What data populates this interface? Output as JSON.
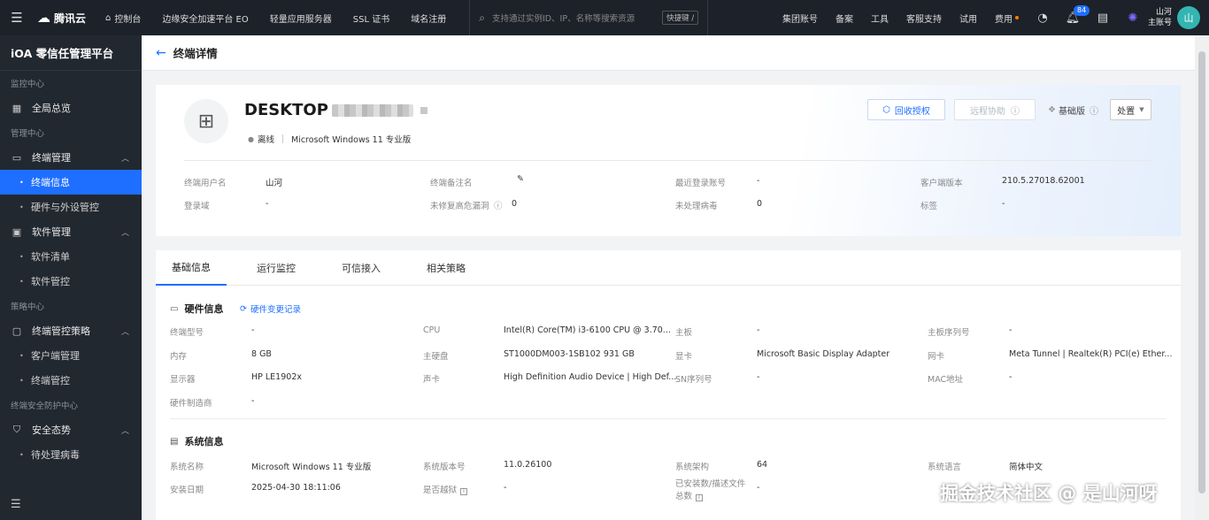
{
  "topbar": {
    "brand": "腾讯云",
    "console": "控制台",
    "nav": [
      "边缘安全加速平台 EO",
      "轻量应用服务器",
      "SSL 证书",
      "域名注册"
    ],
    "search_placeholder": "支持通过实例ID、IP、名称等搜索资源",
    "shortcut": "快捷键 /",
    "right": [
      "集团账号",
      "备案",
      "工具",
      "客服支持",
      "试用",
      "费用"
    ],
    "notification_count": "84",
    "user_name": "山河",
    "user_role": "主账号",
    "avatar": "山"
  },
  "sidebar": {
    "title": "iOA 零信任管理平台",
    "sections": [
      {
        "group": "监控中心",
        "items": [
          {
            "label": "全局总览",
            "icon": "dashboard-icon"
          }
        ]
      },
      {
        "group": "管理中心",
        "items": [
          {
            "label": "终端管理",
            "icon": "terminal-icon",
            "expanded": true,
            "children": [
              "终端信息",
              "硬件与外设管控"
            ]
          },
          {
            "label": "软件管理",
            "icon": "software-icon",
            "expanded": true,
            "children": [
              "软件清单",
              "软件管控"
            ]
          }
        ]
      },
      {
        "group": "策略中心",
        "items": [
          {
            "label": "终端管控策略",
            "icon": "policy-icon",
            "expanded": true,
            "children": [
              "客户端管理",
              "终端管控"
            ]
          }
        ]
      },
      {
        "group": "终端安全防护中心",
        "items": [
          {
            "label": "安全态势",
            "icon": "shield-icon",
            "expanded": true,
            "children": [
              "待处理病毒"
            ]
          }
        ]
      }
    ],
    "active": "终端信息"
  },
  "header": {
    "title": "终端详情"
  },
  "device": {
    "hostname": "DESKTOP",
    "status": "离线",
    "os": "Microsoft Windows 11 专业版",
    "buttons": {
      "revoke": "回收授权",
      "remote": "远程协助",
      "edition": "基础版",
      "handle": "处置"
    },
    "fields": [
      {
        "k": "终端用户名",
        "v": "山河"
      },
      {
        "k": "终端备注名",
        "v": ""
      },
      {
        "k": "最近登录账号",
        "v": "-"
      },
      {
        "k": "客户端版本",
        "v": "210.5.27018.62001"
      },
      {
        "k": "登录域",
        "v": "-"
      },
      {
        "k": "未修复高危漏洞",
        "v": "0"
      },
      {
        "k": "未处理病毒",
        "v": "0"
      },
      {
        "k": "标签",
        "v": "-"
      }
    ]
  },
  "tabs": [
    "基础信息",
    "运行监控",
    "可信接入",
    "相关策略"
  ],
  "hardware": {
    "title": "硬件信息",
    "link": "硬件变更记录",
    "fields": [
      {
        "k": "终端型号",
        "v": "-"
      },
      {
        "k": "CPU",
        "v": "Intel(R) Core(TM) i3-6100 CPU @ 3.70..."
      },
      {
        "k": "主板",
        "v": "-"
      },
      {
        "k": "主板序列号",
        "v": "-"
      },
      {
        "k": "内存",
        "v": "8 GB"
      },
      {
        "k": "主硬盘",
        "v": "ST1000DM003-1SB102 931 GB"
      },
      {
        "k": "显卡",
        "v": "Microsoft Basic Display Adapter"
      },
      {
        "k": "网卡",
        "v": "Meta Tunnel | Realtek(R) PCI(e) Ether..."
      },
      {
        "k": "显示器",
        "v": "HP LE1902x"
      },
      {
        "k": "声卡",
        "v": "High Definition Audio Device | High Def..."
      },
      {
        "k": "SN序列号",
        "v": "-"
      },
      {
        "k": "MAC地址",
        "v": "-"
      },
      {
        "k": "硬件制造商",
        "v": "-"
      }
    ]
  },
  "system": {
    "title": "系统信息",
    "fields": [
      {
        "k": "系统名称",
        "v": "Microsoft Windows 11 专业版"
      },
      {
        "k": "系统版本号",
        "v": "11.0.26100"
      },
      {
        "k": "系统架构",
        "v": "64"
      },
      {
        "k": "系统语言",
        "v": "简体中文"
      },
      {
        "k": "安装日期",
        "v": "2025-04-30 18:11:06"
      },
      {
        "k": "是否越狱",
        "v": "-"
      },
      {
        "k": "已安装数/描述文件总数",
        "v": "-"
      }
    ]
  },
  "watermark": "掘金技术社区 @ 是山河呀"
}
